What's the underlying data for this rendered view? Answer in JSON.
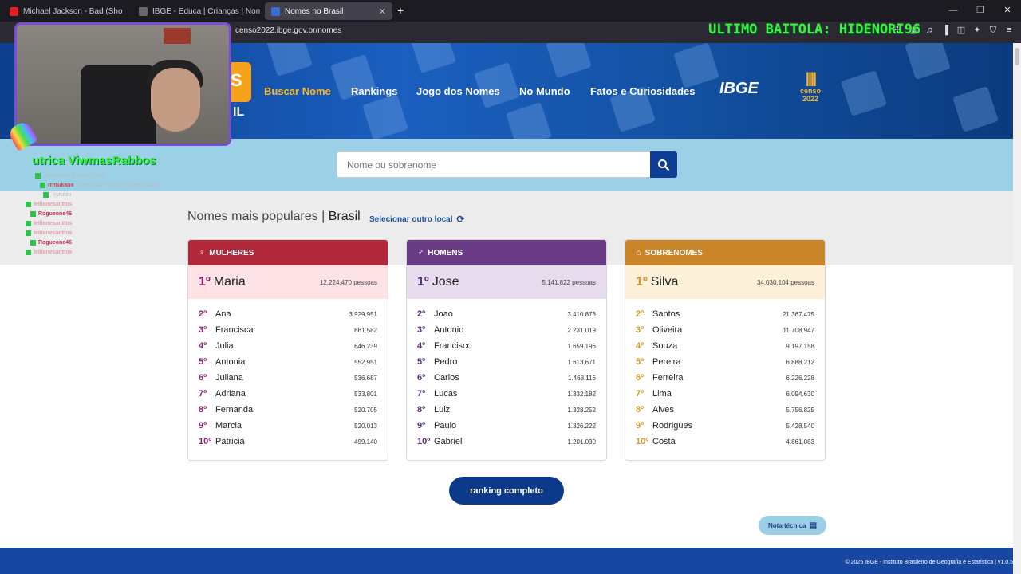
{
  "browser": {
    "tabs": [
      {
        "title": "Michael Jackson - Bad (Sho",
        "active": false,
        "color": "#e02020"
      },
      {
        "title": "IBGE - Educa | Crianças | Nomes do B",
        "active": false,
        "color": "#6a6a6a"
      },
      {
        "title": "Nomes no Brasil",
        "active": true,
        "color": "#3a6fd1"
      }
    ],
    "url": "censo2022.ibge.gov.br/nomes"
  },
  "overlay": {
    "banner": "ULTIMO BAITOLA: HIDENORI96",
    "chat_header": "utrica    ViwmasRabbos",
    "chat": [
      {
        "user": "",
        "text": "seu nome e wesler, smd",
        "color": "#c9a84a"
      },
      {
        "user": "rrntukano",
        "text": "quero falar mal do michael jakson",
        "color": "#d04040"
      },
      {
        "user": "",
        "text": "cyrublo",
        "color": "#888"
      },
      {
        "user": "leilianesanttos",
        "text": "",
        "color": "#e0a0b0"
      },
      {
        "user": "Rogueone46",
        "text": "",
        "color": "#c03050"
      },
      {
        "user": "leilianesanttos",
        "text": "",
        "color": "#e0a0b0"
      },
      {
        "user": "leilianesanttos",
        "text": "",
        "color": "#e0a0b0"
      },
      {
        "user": "Rogueone46",
        "text": "",
        "color": "#c03050"
      },
      {
        "user": "leilianesanttos",
        "text": "",
        "color": "#e0a0b0"
      }
    ]
  },
  "site": {
    "logo_text": "S",
    "logo_sub": "IL",
    "menu": [
      "Buscar Nome",
      "Rankings",
      "Jogo dos Nomes",
      "No Mundo",
      "Fatos e Curiosidades"
    ],
    "ibge_logo": "IBGE",
    "censo_logo": "censo 2022",
    "search": {
      "placeholder": "Nome ou sobrenome"
    },
    "section_title": "Nomes mais populares |",
    "location": "Brasil",
    "change_location": "Selecionar outro local",
    "ranking_button": "ranking completo",
    "nota_button": "Nota técnica",
    "footer": "© 2025 IBGE - Instituto Brasileiro de Geografia e Estatística | v1.0.5"
  },
  "cards": [
    {
      "title": "MULHERES",
      "icon": "female-icon",
      "head_color": "#b0283a",
      "top_bg": "#fde2e6",
      "rank_color": "#8e1e6e",
      "top": {
        "rank": "1º",
        "name": "Maria",
        "count": "12.224.470 pessoas"
      },
      "rows": [
        {
          "rank": "2º",
          "name": "Ana",
          "value": "3.929.951"
        },
        {
          "rank": "3º",
          "name": "Francisca",
          "value": "661.582"
        },
        {
          "rank": "4º",
          "name": "Julia",
          "value": "646.239"
        },
        {
          "rank": "5º",
          "name": "Antonia",
          "value": "552.951"
        },
        {
          "rank": "6º",
          "name": "Juliana",
          "value": "536.687"
        },
        {
          "rank": "7º",
          "name": "Adriana",
          "value": "533.801"
        },
        {
          "rank": "8º",
          "name": "Fernanda",
          "value": "520.705"
        },
        {
          "rank": "9º",
          "name": "Marcia",
          "value": "520.013"
        },
        {
          "rank": "10º",
          "name": "Patricia",
          "value": "499.140"
        }
      ]
    },
    {
      "title": "HOMENS",
      "icon": "male-icon",
      "head_color": "#6a3c86",
      "top_bg": "#e6dcee",
      "rank_color": "#5b2f78",
      "top": {
        "rank": "1º",
        "name": "Jose",
        "count": "5.141.822 pessoas"
      },
      "rows": [
        {
          "rank": "2º",
          "name": "Joao",
          "value": "3.410.873"
        },
        {
          "rank": "3º",
          "name": "Antonio",
          "value": "2.231.019"
        },
        {
          "rank": "4º",
          "name": "Francisco",
          "value": "1.659.196"
        },
        {
          "rank": "5º",
          "name": "Pedro",
          "value": "1.613.671"
        },
        {
          "rank": "6º",
          "name": "Carlos",
          "value": "1.468.116"
        },
        {
          "rank": "7º",
          "name": "Lucas",
          "value": "1.332.182"
        },
        {
          "rank": "8º",
          "name": "Luiz",
          "value": "1.328.252"
        },
        {
          "rank": "9º",
          "name": "Paulo",
          "value": "1.326.222"
        },
        {
          "rank": "10º",
          "name": "Gabriel",
          "value": "1.201.030"
        }
      ]
    },
    {
      "title": "SOBRENOMES",
      "icon": "family-icon",
      "head_color": "#c98528",
      "top_bg": "#fdf0d9",
      "rank_color": "#d69a2a",
      "top": {
        "rank": "1º",
        "name": "Silva",
        "count": "34.030.104 pessoas"
      },
      "rows": [
        {
          "rank": "2º",
          "name": "Santos",
          "value": "21.367.475"
        },
        {
          "rank": "3º",
          "name": "Oliveira",
          "value": "11.708.947"
        },
        {
          "rank": "4º",
          "name": "Souza",
          "value": "9.197.158"
        },
        {
          "rank": "5º",
          "name": "Pereira",
          "value": "6.888.212"
        },
        {
          "rank": "6º",
          "name": "Ferreira",
          "value": "6.226.228"
        },
        {
          "rank": "7º",
          "name": "Lima",
          "value": "6.094.630"
        },
        {
          "rank": "8º",
          "name": "Alves",
          "value": "5.756.825"
        },
        {
          "rank": "9º",
          "name": "Rodrigues",
          "value": "5.428.540"
        },
        {
          "rank": "10º",
          "name": "Costa",
          "value": "4.861.083"
        }
      ]
    }
  ]
}
